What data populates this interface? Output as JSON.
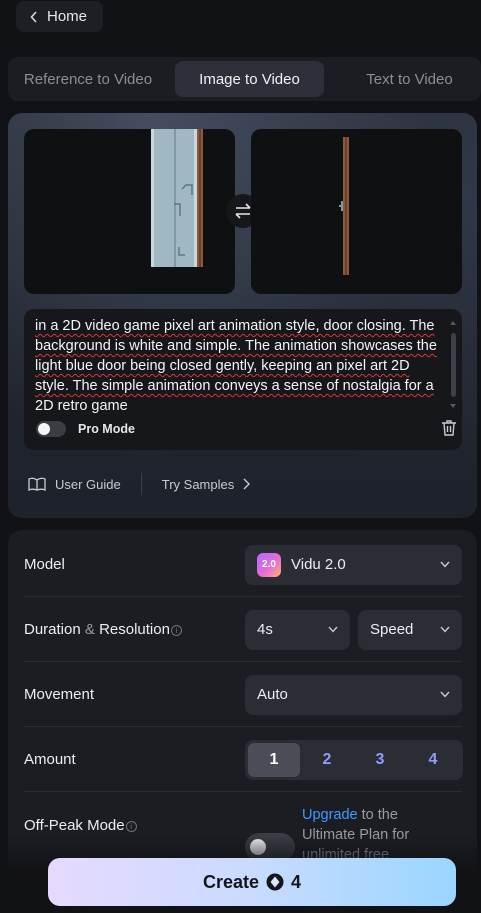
{
  "header": {
    "home_label": "Home"
  },
  "tabs": [
    {
      "label": "Reference to Video",
      "active": false
    },
    {
      "label": "Image to Video",
      "active": true
    },
    {
      "label": "Text to Video",
      "active": false
    }
  ],
  "prompt": {
    "text": "in a 2D video game pixel art animation style, door closing. The background is white and simple. The animation showcases the light blue door being closed gently, keeping an pixel art 2D style. The simple animation conveys a sense of nostalgia for a 2D retro game",
    "pro_mode_label": "Pro Mode",
    "pro_mode_on": false
  },
  "helpers": {
    "user_guide": "User Guide",
    "try_samples": "Try Samples"
  },
  "settings": {
    "model": {
      "label": "Model",
      "value": "Vidu 2.0",
      "logo_text": "2.0"
    },
    "duration": {
      "label_a": "Duration",
      "amp": "&",
      "label_b": "Resolution",
      "info": "i",
      "duration_value": "4s",
      "resolution_value": "Speed"
    },
    "movement": {
      "label": "Movement",
      "value": "Auto"
    },
    "amount": {
      "label": "Amount",
      "options": [
        "1",
        "2",
        "3",
        "4"
      ],
      "selected": "1"
    },
    "offpeak": {
      "label": "Off-Peak Mode",
      "info": "i",
      "link": "Upgrade",
      "text": "to the Ultimate Plan for unlimited free",
      "on": false
    }
  },
  "create": {
    "label": "Create",
    "cost": "4"
  },
  "colors": {
    "accent_link": "#3d9bff",
    "amount_text": "#8f9cff",
    "create_gradient_start": "#e7d9ff",
    "create_gradient_end": "#9ad6ff"
  }
}
